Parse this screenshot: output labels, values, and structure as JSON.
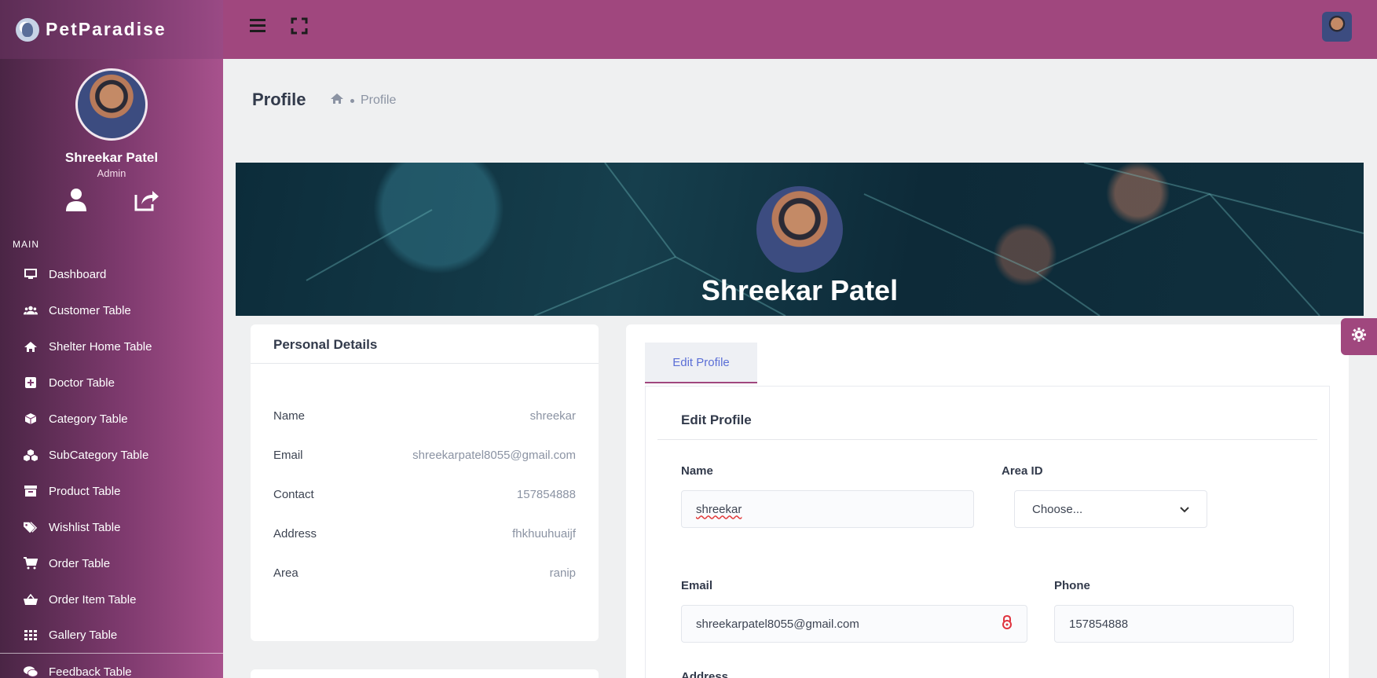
{
  "app": {
    "brand": "PetParadise"
  },
  "user": {
    "name": "Shreekar Patel",
    "role": "Admin"
  },
  "sidebar": {
    "section_title": "MAIN",
    "items": [
      {
        "label": "Dashboard",
        "icon": "monitor-icon"
      },
      {
        "label": "Customer Table",
        "icon": "users-icon"
      },
      {
        "label": "Shelter Home Table",
        "icon": "home-icon"
      },
      {
        "label": "Doctor Table",
        "icon": "plus-square-icon"
      },
      {
        "label": "Category Table",
        "icon": "cube-icon"
      },
      {
        "label": "SubCategory Table",
        "icon": "cubes-icon"
      },
      {
        "label": "Product Table",
        "icon": "archive-icon"
      },
      {
        "label": "Wishlist Table",
        "icon": "tags-icon"
      },
      {
        "label": "Order Table",
        "icon": "cart-icon"
      },
      {
        "label": "Order Item Table",
        "icon": "basket-icon"
      },
      {
        "label": "Gallery Table",
        "icon": "grid-icon"
      },
      {
        "label": "Feedback Table",
        "icon": "comments-icon"
      }
    ]
  },
  "page": {
    "title": "Profile",
    "breadcrumb": "Profile"
  },
  "cover": {
    "name": "Shreekar Patel"
  },
  "personal_details": {
    "title": "Personal Details",
    "rows": [
      {
        "key": "Name",
        "value": "shreekar"
      },
      {
        "key": "Email",
        "value": "shreekarpatel8055@gmail.com"
      },
      {
        "key": "Contact",
        "value": "157854888"
      },
      {
        "key": "Address",
        "value": "fhkhuuhuaijf"
      },
      {
        "key": "Area",
        "value": "ranip"
      }
    ]
  },
  "edit_profile": {
    "tab_label": "Edit Profile",
    "title": "Edit Profile",
    "name_label": "Name",
    "name_value": "shreekar",
    "area_label": "Area ID",
    "area_value": "Choose...",
    "email_label": "Email",
    "email_value": "shreekarpatel8055@gmail.com",
    "phone_label": "Phone",
    "phone_value": "157854888",
    "address_label": "Address"
  },
  "colors": {
    "topbar": "#a0477e",
    "accent_tab": "#5b6fd6",
    "sidebar_dark": "#4a2545"
  }
}
